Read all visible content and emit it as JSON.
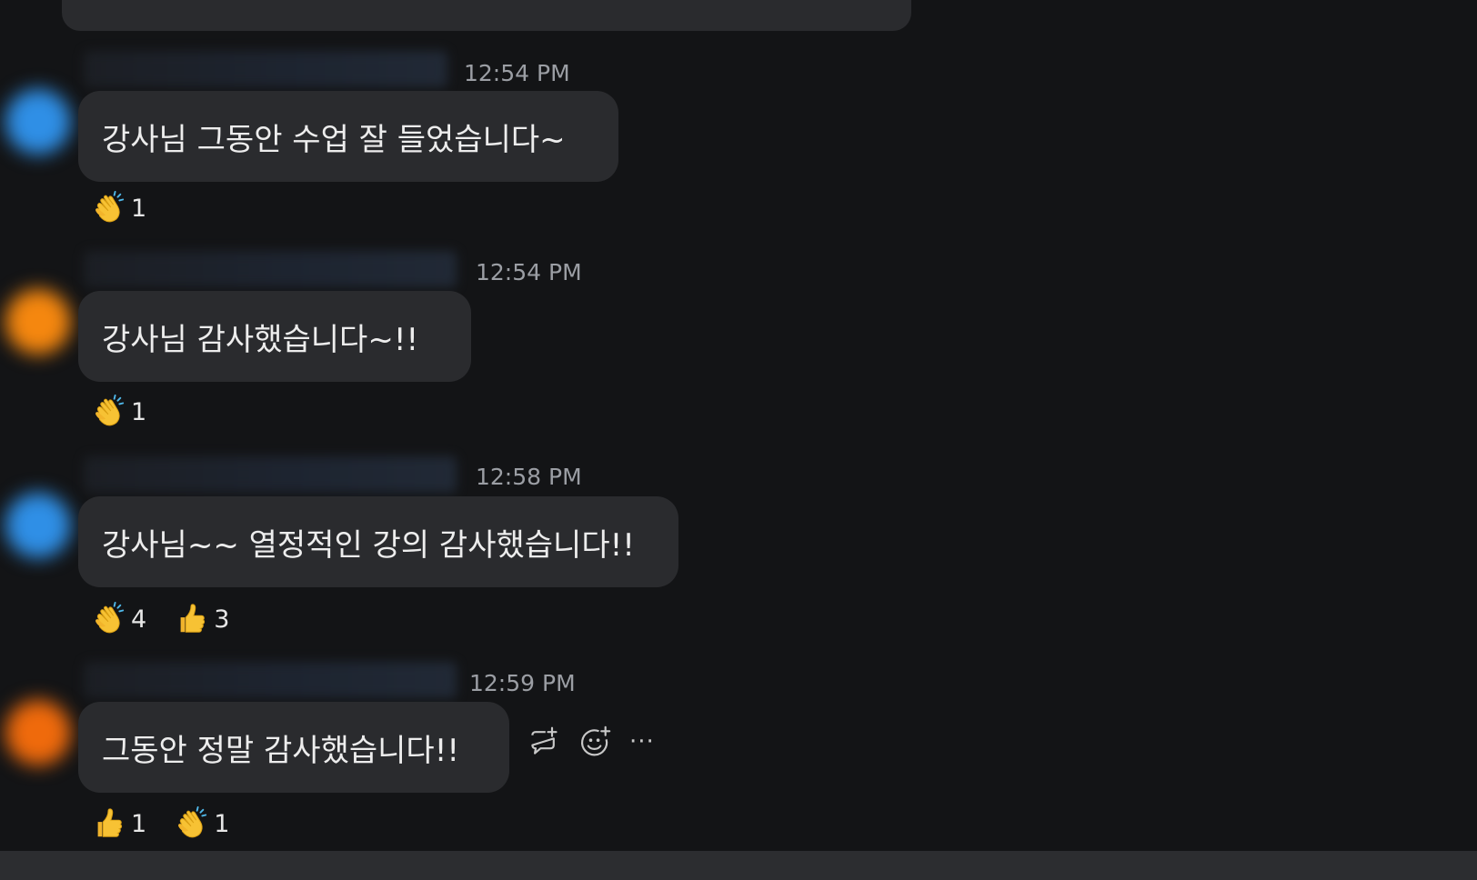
{
  "messages": [
    {
      "time": "12:54 PM",
      "text": "강사님 그동안 수업 잘 들었습니다~",
      "avatar_color": "#2f8fe6",
      "reactions": [
        {
          "emoji": "clapping-hands",
          "count": "1"
        }
      ]
    },
    {
      "time": "12:54 PM",
      "text": "강사님 감사했습니다~!!",
      "avatar_color": "#f5870f",
      "reactions": [
        {
          "emoji": "clapping-hands",
          "count": "1"
        }
      ]
    },
    {
      "time": "12:58 PM",
      "text": "강사님~~ 열정적인 강의 감사했습니다!!",
      "avatar_color": "#2f8fe6",
      "reactions": [
        {
          "emoji": "clapping-hands",
          "count": "4"
        },
        {
          "emoji": "thumbs-up",
          "count": "3"
        }
      ]
    },
    {
      "time": "12:59 PM",
      "text": "그동안 정말 감사했습니다!!",
      "avatar_color": "#ef6a0c",
      "reactions": [
        {
          "emoji": "thumbs-up",
          "count": "1"
        },
        {
          "emoji": "clapping-hands",
          "count": "1"
        }
      ],
      "hover_actions": {
        "more_label": "···"
      }
    }
  ],
  "colors": {
    "background": "#131416",
    "bubble": "#2a2b2e",
    "timestamp": "#9b9ea4",
    "text": "#ededed",
    "emoji_yellow": "#f7c234"
  }
}
